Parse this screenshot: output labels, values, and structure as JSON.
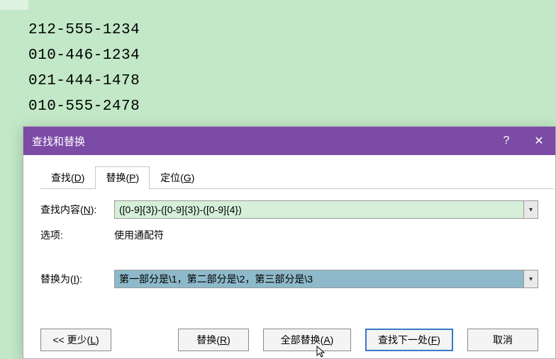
{
  "document": {
    "lines": [
      "212-555-1234",
      "010-446-1234",
      "021-444-1478",
      "010-555-2478"
    ]
  },
  "dialog": {
    "title": "查找和替换",
    "help_label": "?",
    "close_label": "✕",
    "tabs": {
      "find": {
        "prefix": "查找(",
        "hotkey": "D",
        "suffix": ")"
      },
      "replace": {
        "prefix": "替换(",
        "hotkey": "P",
        "suffix": ")"
      },
      "goto": {
        "prefix": "定位(",
        "hotkey": "G",
        "suffix": ")"
      }
    },
    "find_label": {
      "prefix": "查找内容(",
      "hotkey": "N",
      "suffix": "):"
    },
    "find_value": "([0-9]{3})-([0-9]{3})-([0-9]{4})",
    "options_label": "选项:",
    "options_value": "使用通配符",
    "replace_label": {
      "prefix": "替换为(",
      "hotkey": "I",
      "suffix": "):"
    },
    "replace_value": "第一部分是\\1，第二部分是\\2，第三部分是\\3",
    "buttons": {
      "less": {
        "prefix": "<< 更少(",
        "hotkey": "L",
        "suffix": ")"
      },
      "replace": {
        "prefix": "替换(",
        "hotkey": "R",
        "suffix": ")"
      },
      "replace_all": {
        "prefix": "全部替换(",
        "hotkey": "A",
        "suffix": ")"
      },
      "find_next": {
        "prefix": "查找下一处(",
        "hotkey": "F",
        "suffix": ")"
      },
      "cancel": "取消"
    }
  }
}
